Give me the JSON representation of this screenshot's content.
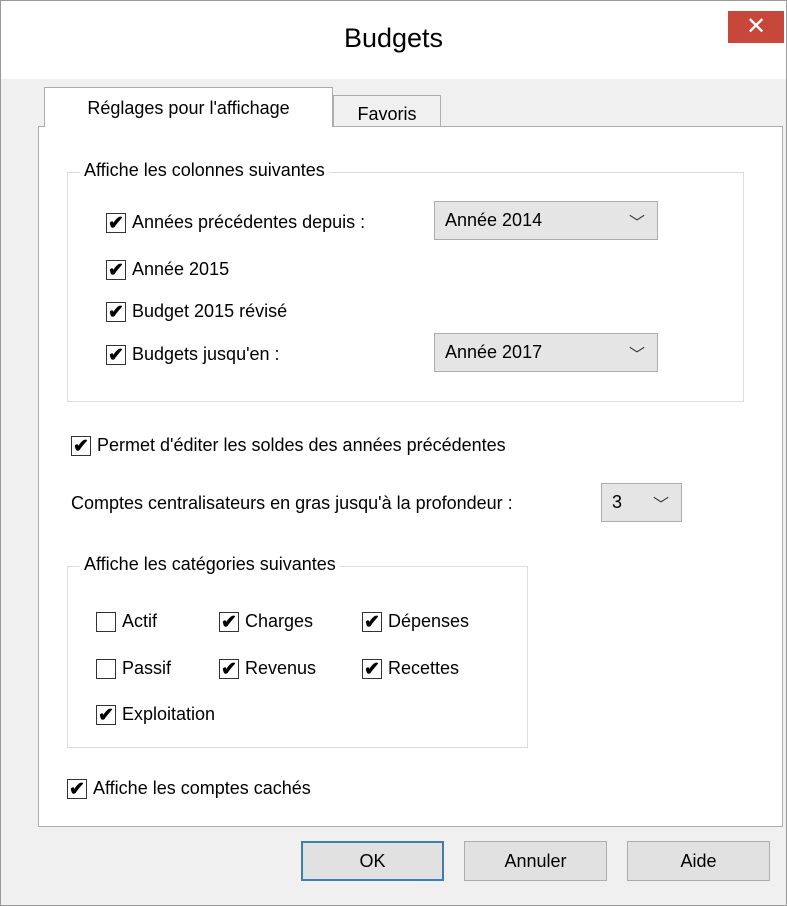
{
  "window": {
    "title": "Budgets",
    "close_glyph": "✕"
  },
  "tabs": [
    {
      "label": "Réglages pour l'affichage"
    },
    {
      "label": "Favoris"
    }
  ],
  "columns_group": {
    "legend": "Affiche les colonnes suivantes",
    "items": [
      {
        "label": "Années précédentes depuis :",
        "checked": true
      },
      {
        "label": "Année 2015",
        "checked": true
      },
      {
        "label": "Budget 2015 révisé",
        "checked": true
      },
      {
        "label": "Budgets jusqu'en :",
        "checked": true
      }
    ],
    "from_year": "Année  2014",
    "to_year": "Année  2017"
  },
  "edit_balances": {
    "label": "Permet d'éditer les soldes des années précédentes",
    "checked": true
  },
  "depth": {
    "label": "Comptes centralisateurs en gras jusqu'à la profondeur :",
    "value": "3"
  },
  "categories_group": {
    "legend": "Affiche les catégories suivantes",
    "items": [
      {
        "label": "Actif",
        "checked": false
      },
      {
        "label": "Charges",
        "checked": true
      },
      {
        "label": "Dépenses",
        "checked": true
      },
      {
        "label": "Passif",
        "checked": false
      },
      {
        "label": "Revenus",
        "checked": true
      },
      {
        "label": "Recettes",
        "checked": true
      },
      {
        "label": "Exploitation",
        "checked": true
      }
    ]
  },
  "hidden_accounts": {
    "label": "Affiche les comptes cachés",
    "checked": true
  },
  "buttons": {
    "ok": "OK",
    "cancel": "Annuler",
    "help": "Aide"
  },
  "icons": {
    "check": "✔",
    "chevron": "﹀"
  }
}
